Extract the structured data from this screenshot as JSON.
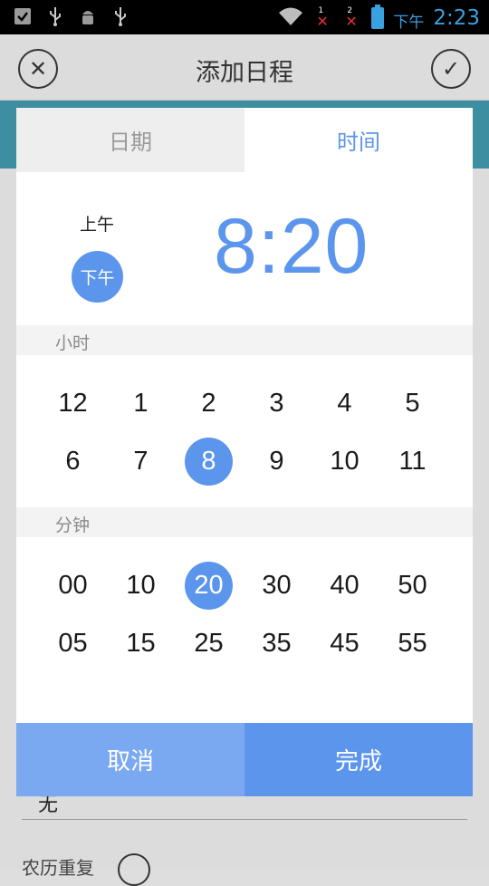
{
  "status_bar": {
    "ampm": "下午",
    "time": "2:23",
    "sim1": "1",
    "sim2": "2",
    "icons": [
      "checkbox-icon",
      "usb-icon",
      "android-debug-icon",
      "usb-icon",
      "wifi-icon",
      "signal-none-icon",
      "signal-none-icon",
      "battery-icon"
    ]
  },
  "app_bar": {
    "title": "添加日程",
    "close_icon": "close-icon",
    "confirm_icon": "check-icon"
  },
  "background": {
    "field_value": "无",
    "label": "农历重复"
  },
  "dialog": {
    "tabs": [
      {
        "label": "日期",
        "selected": false
      },
      {
        "label": "时间",
        "selected": true
      }
    ],
    "am_label": "上午",
    "pm_label": "下午",
    "time_display": "8:20",
    "hour_section": "小时",
    "minute_section": "分钟",
    "hours": [
      "12",
      "1",
      "2",
      "3",
      "4",
      "5",
      "6",
      "7",
      "8",
      "9",
      "10",
      "11"
    ],
    "selected_hour": "8",
    "minutes": [
      "00",
      "10",
      "20",
      "30",
      "40",
      "50",
      "05",
      "15",
      "25",
      "35",
      "45",
      "55"
    ],
    "selected_minute": "20",
    "cancel_label": "取消",
    "done_label": "完成"
  },
  "colors": {
    "accent": "#5b95ec",
    "cancel": "#7aa9f2",
    "status_accent": "#3aa0e0",
    "teal": "#3c8ea0"
  }
}
